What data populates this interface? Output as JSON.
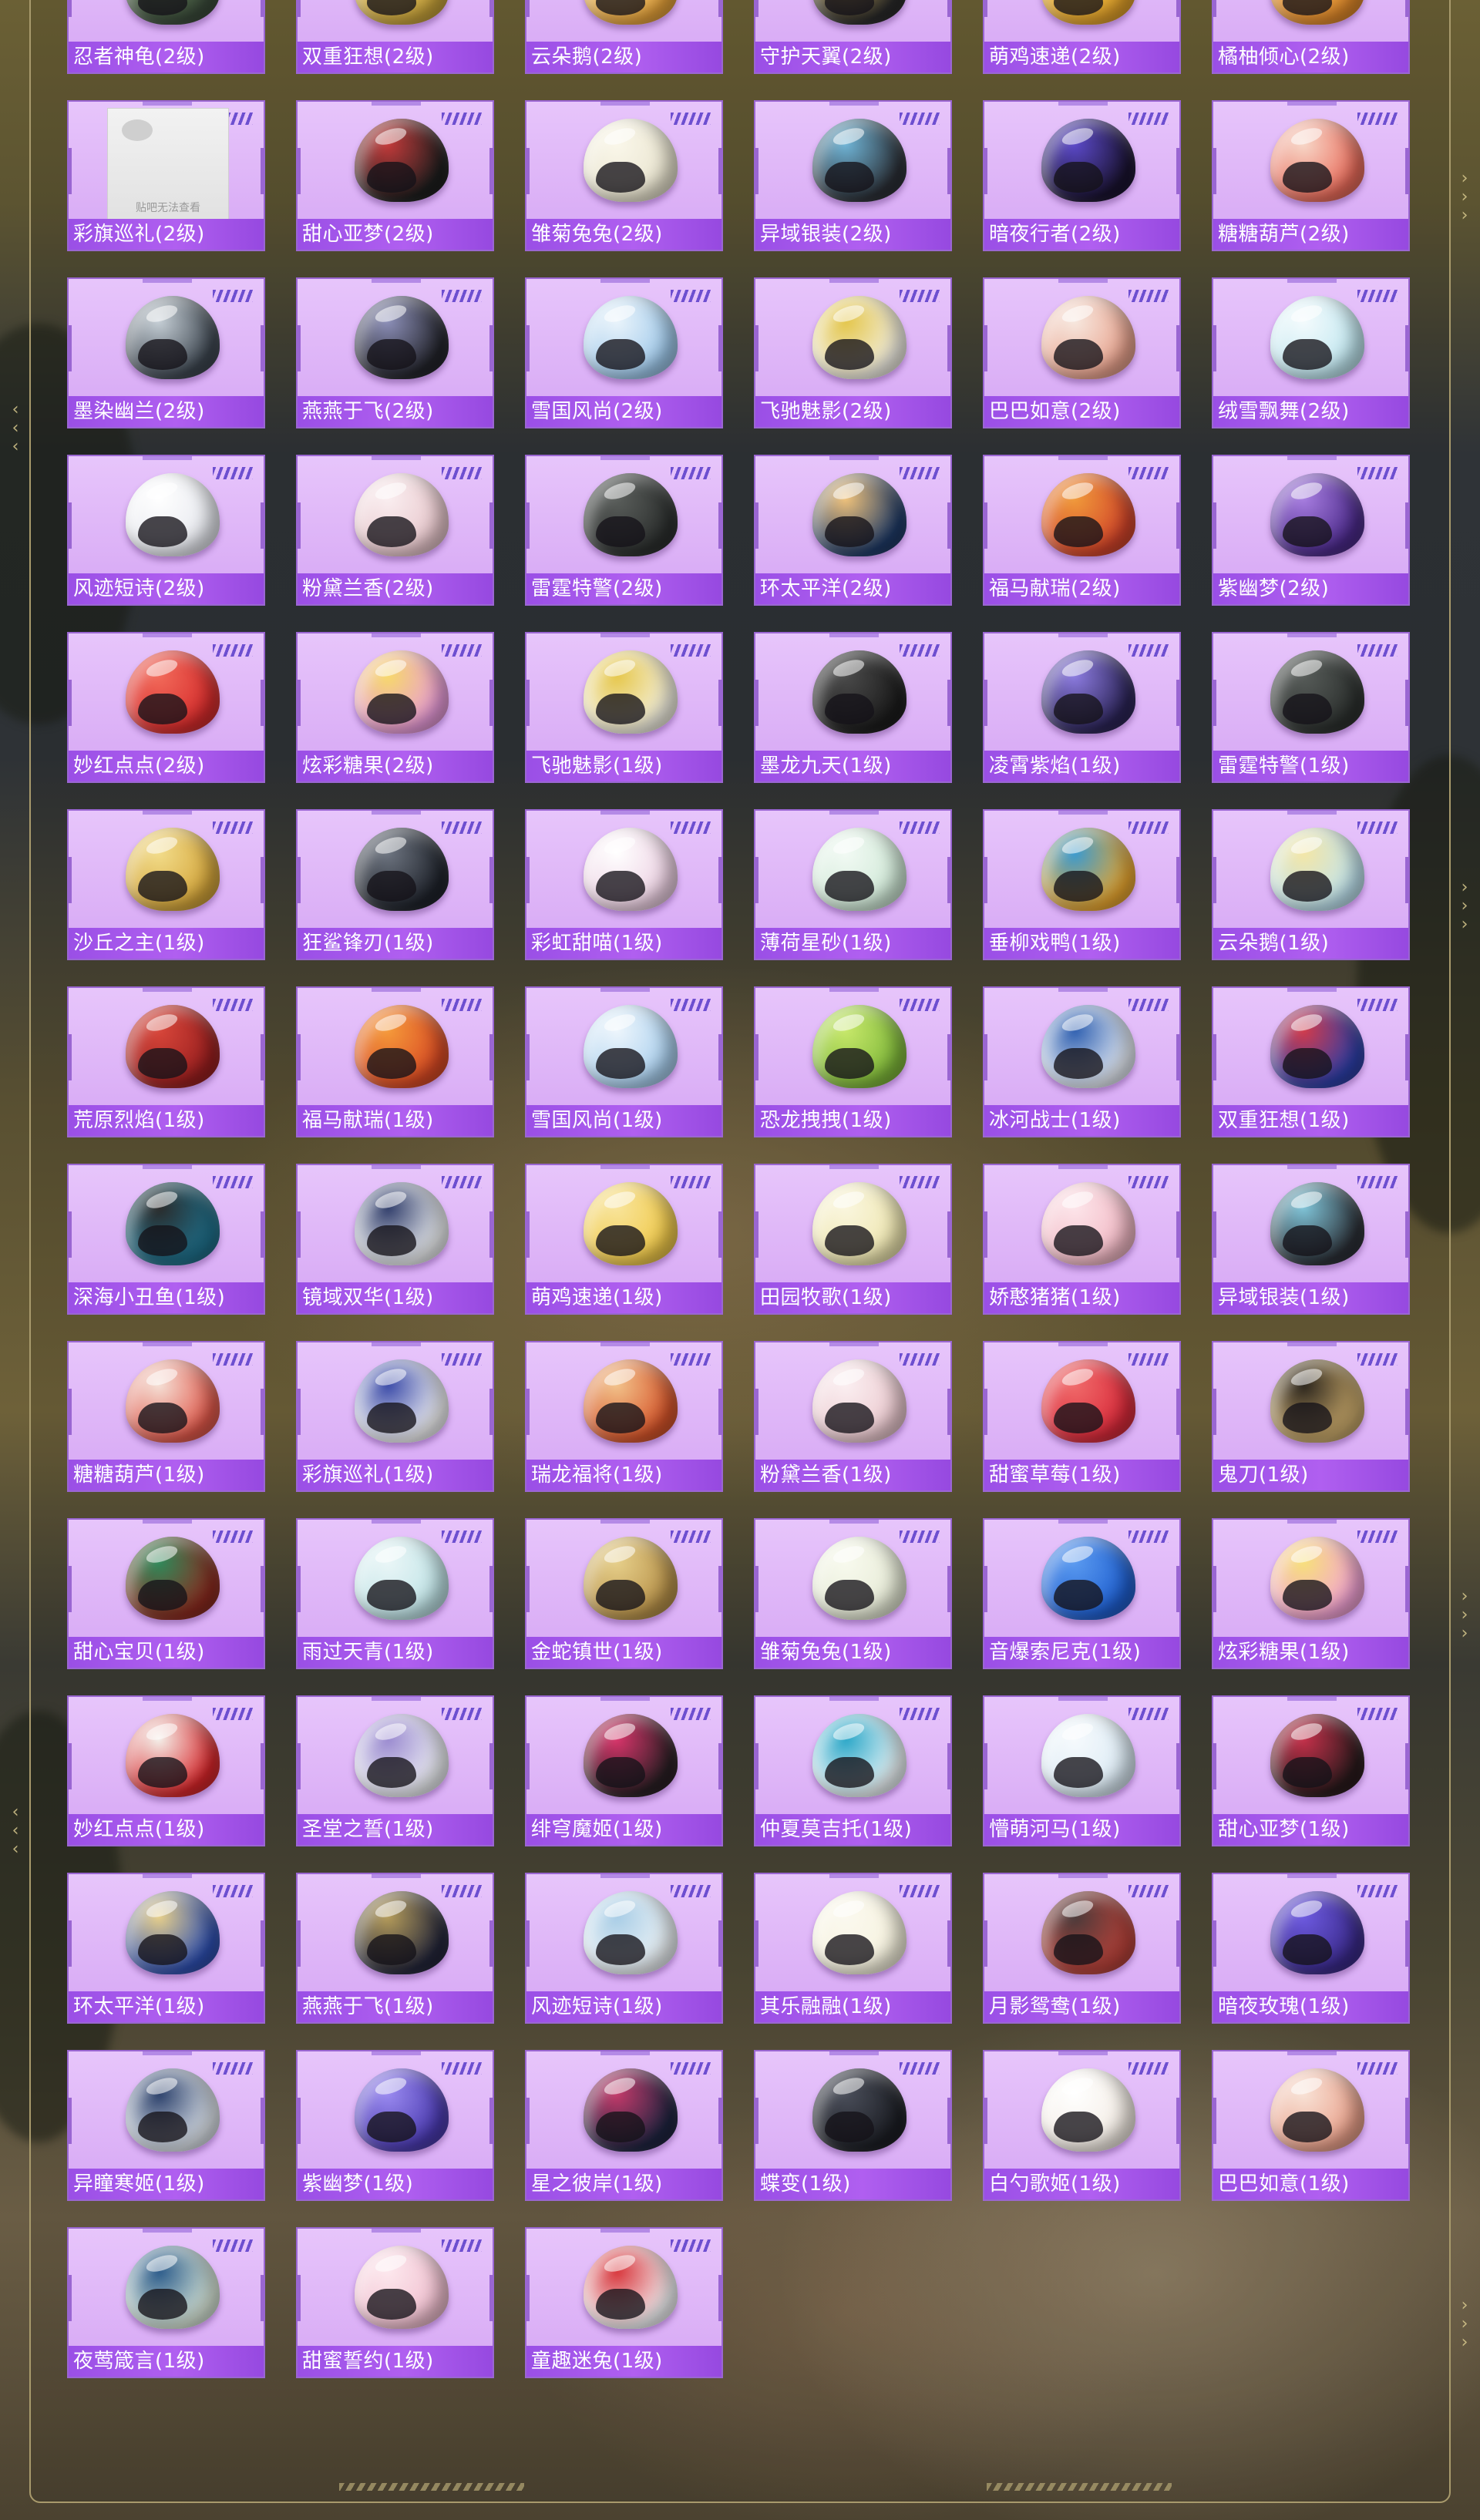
{
  "broken_image_text": "贴吧无法查看",
  "colors": {
    "card_bg": "#ddb3f7",
    "label_bg": "#a855f0",
    "label_text": "#ffffff"
  },
  "items": [
    {
      "name": "忍者神龟(2级)",
      "c1": "#3a4a3a",
      "c2": "#6b8a5a",
      "icon": "helmet-icon"
    },
    {
      "name": "双重狂想(2级)",
      "c1": "#c7a23a",
      "c2": "#efd17a",
      "icon": "helmet-icon"
    },
    {
      "name": "云朵鹅(2级)",
      "c1": "#e6a23a",
      "c2": "#f7e7b0",
      "icon": "helmet-icon"
    },
    {
      "name": "守护天翼(2级)",
      "c1": "#2a2a2a",
      "c2": "#d4b25a",
      "icon": "helmet-icon"
    },
    {
      "name": "萌鸡速递(2级)",
      "c1": "#e2a12a",
      "c2": "#f4d25a",
      "icon": "helmet-icon"
    },
    {
      "name": "橘柚倾心(2级)",
      "c1": "#e0892a",
      "c2": "#f5c06a",
      "icon": "helmet-icon"
    },
    {
      "name": "彩旗巡礼(2级)",
      "c1": "#e8e8e8",
      "c2": "#ffffff",
      "icon": "broken-image-icon",
      "broken": true
    },
    {
      "name": "甜心亚梦(2级)",
      "c1": "#1e1e1e",
      "c2": "#c33a3a",
      "icon": "helmet-icon"
    },
    {
      "name": "雏菊兔兔(2级)",
      "c1": "#e9e4cf",
      "c2": "#faf7ea",
      "icon": "helmet-icon"
    },
    {
      "name": "异域银装(2级)",
      "c1": "#2b2f36",
      "c2": "#6fb4d6",
      "icon": "helmet-icon"
    },
    {
      "name": "暗夜行者(2级)",
      "c1": "#1a1330",
      "c2": "#5b49c9",
      "icon": "helmet-icon"
    },
    {
      "name": "糖糖葫芦(2级)",
      "c1": "#e96b5a",
      "c2": "#f7d7c8",
      "icon": "helmet-icon"
    },
    {
      "name": "墨染幽兰(2级)",
      "c1": "#3d4650",
      "c2": "#c6cfd6",
      "icon": "helmet-icon"
    },
    {
      "name": "燕燕于飞(2级)",
      "c1": "#23242b",
      "c2": "#8c8fb8",
      "icon": "helmet-icon"
    },
    {
      "name": "雪国风尚(2级)",
      "c1": "#9ec8ea",
      "c2": "#eaf4fb",
      "icon": "helmet-icon"
    },
    {
      "name": "飞驰魅影(2级)",
      "c1": "#f2efe4",
      "c2": "#e4c64a",
      "icon": "helmet-icon"
    },
    {
      "name": "巴巴如意(2级)",
      "c1": "#e8a28d",
      "c2": "#f7e8df",
      "icon": "helmet-icon"
    },
    {
      "name": "绒雪飘舞(2级)",
      "c1": "#bfe6ef",
      "c2": "#f4fbfd",
      "icon": "helmet-icon"
    },
    {
      "name": "风迹短诗(2级)",
      "c1": "#e6e8ee",
      "c2": "#ffffff",
      "icon": "helmet-icon"
    },
    {
      "name": "粉黛兰香(2级)",
      "c1": "#e7c6cb",
      "c2": "#faeef0",
      "icon": "helmet-icon"
    },
    {
      "name": "雷霆特警(2级)",
      "c1": "#2c2f2e",
      "c2": "#5a5e5b",
      "icon": "helmet-icon"
    },
    {
      "name": "环太平洋(2级)",
      "c1": "#1f3a66",
      "c2": "#f0c27a",
      "icon": "helmet-icon"
    },
    {
      "name": "福马献瑞(2级)",
      "c1": "#d2442a",
      "c2": "#f09a3a",
      "icon": "helmet-icon"
    },
    {
      "name": "紫幽梦(2级)",
      "c1": "#4b2a8a",
      "c2": "#a77de0",
      "icon": "helmet-icon"
    },
    {
      "name": "妙红点点(2级)",
      "c1": "#d62c2c",
      "c2": "#f26a5a",
      "icon": "helmet-icon"
    },
    {
      "name": "炫彩糖果(2级)",
      "c1": "#e79ad8",
      "c2": "#f7d96a",
      "icon": "helmet-icon"
    },
    {
      "name": "飞驰魅影(1级)",
      "c1": "#f4f1e2",
      "c2": "#e6c74a",
      "icon": "helmet-icon"
    },
    {
      "name": "墨龙九天(1级)",
      "c1": "#1c1c1c",
      "c2": "#4a4a4a",
      "icon": "helmet-icon"
    },
    {
      "name": "凌霄紫焰(1级)",
      "c1": "#2b2456",
      "c2": "#8c7be0",
      "icon": "helmet-icon"
    },
    {
      "name": "雷霆特警(1级)",
      "c1": "#2c302e",
      "c2": "#575c59",
      "icon": "helmet-icon"
    },
    {
      "name": "沙丘之主(1级)",
      "c1": "#d4a53a",
      "c2": "#f2dc8a",
      "icon": "helmet-icon"
    },
    {
      "name": "狂鲨锋刃(1级)",
      "c1": "#1f232b",
      "c2": "#6d7480",
      "icon": "helmet-icon"
    },
    {
      "name": "彩虹甜喵(1级)",
      "c1": "#ecd0e2",
      "c2": "#ffffff",
      "icon": "helmet-icon"
    },
    {
      "name": "薄荷星砂(1级)",
      "c1": "#cfe8d6",
      "c2": "#f2faf4",
      "icon": "helmet-icon"
    },
    {
      "name": "垂柳戏鸭(1级)",
      "c1": "#e8a630",
      "c2": "#3a9ad0",
      "icon": "helmet-icon"
    },
    {
      "name": "云朵鹅(1级)",
      "c1": "#bfe3ef",
      "c2": "#f4e6a6",
      "icon": "helmet-icon"
    },
    {
      "name": "荒原烈焰(1级)",
      "c1": "#9a1f1f",
      "c2": "#d8463a",
      "icon": "helmet-icon"
    },
    {
      "name": "福马献瑞(1级)",
      "c1": "#d94a24",
      "c2": "#f59a3a",
      "icon": "helmet-icon"
    },
    {
      "name": "雪国风尚(1级)",
      "c1": "#a9cfee",
      "c2": "#eef6fc",
      "icon": "helmet-icon"
    },
    {
      "name": "恐龙拽拽(1级)",
      "c1": "#7fb83a",
      "c2": "#c7e86a",
      "icon": "helmet-icon"
    },
    {
      "name": "冰河战士(1级)",
      "c1": "#e6ecf5",
      "c2": "#2e5fb0",
      "icon": "helmet-icon"
    },
    {
      "name": "双重狂想(1级)",
      "c1": "#2d3fa8",
      "c2": "#d23a4a",
      "icon": "helmet-icon"
    },
    {
      "name": "深海小丑鱼(1级)",
      "c1": "#1f6f8a",
      "c2": "#2a2a2a",
      "icon": "helmet-icon"
    },
    {
      "name": "镜域双华(1级)",
      "c1": "#eef0f2",
      "c2": "#2f3c6a",
      "icon": "helmet-icon"
    },
    {
      "name": "萌鸡速递(1级)",
      "c1": "#f0c94a",
      "c2": "#f8e49a",
      "icon": "helmet-icon"
    },
    {
      "name": "田园牧歌(1级)",
      "c1": "#eee6b0",
      "c2": "#faf6de",
      "icon": "helmet-icon"
    },
    {
      "name": "娇憨猪猪(1级)",
      "c1": "#f1b8c4",
      "c2": "#fde5ea",
      "icon": "helmet-icon"
    },
    {
      "name": "异域银装(1级)",
      "c1": "#2b2f36",
      "c2": "#7fc4d8",
      "icon": "helmet-icon"
    },
    {
      "name": "糖糖葫芦(1级)",
      "c1": "#e0584a",
      "c2": "#f5e0d6",
      "icon": "helmet-icon"
    },
    {
      "name": "彩旗巡礼(1级)",
      "c1": "#f4f4f6",
      "c2": "#3a4aa8",
      "icon": "helmet-icon"
    },
    {
      "name": "瑞龙福将(1级)",
      "c1": "#d6542a",
      "c2": "#f2c28a",
      "icon": "helmet-icon"
    },
    {
      "name": "粉黛兰香(1级)",
      "c1": "#ebc9cf",
      "c2": "#fbeff1",
      "icon": "helmet-icon"
    },
    {
      "name": "甜蜜草莓(1级)",
      "c1": "#d92a3a",
      "c2": "#f06a6a",
      "icon": "helmet-icon"
    },
    {
      "name": "鬼刀(1级)",
      "c1": "#c8a86a",
      "c2": "#2a241c",
      "icon": "helmet-icon"
    },
    {
      "name": "甜心宝贝(1级)",
      "c1": "#8a2a1f",
      "c2": "#2e8a5a",
      "icon": "helmet-icon"
    },
    {
      "name": "雨过天青(1级)",
      "c1": "#bfe3e6",
      "c2": "#eaf6f7",
      "icon": "helmet-icon"
    },
    {
      "name": "金蛇镇世(1级)",
      "c1": "#b8924a",
      "c2": "#e6cf8a",
      "icon": "helmet-icon"
    },
    {
      "name": "雏菊兔兔(1级)",
      "c1": "#e6ead6",
      "c2": "#f8faee",
      "icon": "helmet-icon"
    },
    {
      "name": "音爆索尼克(1级)",
      "c1": "#1f5fd0",
      "c2": "#5a9af0",
      "icon": "helmet-icon"
    },
    {
      "name": "炫彩糖果(1级)",
      "c1": "#f2a2d4",
      "c2": "#f7e07a",
      "icon": "helmet-icon"
    },
    {
      "name": "妙红点点(1级)",
      "c1": "#d8262a",
      "c2": "#f4f0ea",
      "icon": "helmet-icon"
    },
    {
      "name": "圣堂之誓(1级)",
      "c1": "#eef0f4",
      "c2": "#9a8ad0",
      "icon": "helmet-icon"
    },
    {
      "name": "绯穹魔姬(1级)",
      "c1": "#2a1f24",
      "c2": "#d8346a",
      "icon": "helmet-icon"
    },
    {
      "name": "仲夏莫吉托(1级)",
      "c1": "#eef6f8",
      "c2": "#2aa7c8",
      "icon": "helmet-icon"
    },
    {
      "name": "懵萌河马(1级)",
      "c1": "#dbeaf4",
      "c2": "#f6fafd",
      "icon": "helmet-icon"
    },
    {
      "name": "甜心亚梦(1级)",
      "c1": "#2a1a1c",
      "c2": "#c4304a",
      "icon": "helmet-icon"
    },
    {
      "name": "环太平洋(1级)",
      "c1": "#2e4fb0",
      "c2": "#e8d08a",
      "icon": "helmet-icon"
    },
    {
      "name": "燕燕于飞(1级)",
      "c1": "#24263a",
      "c2": "#b59c5a",
      "icon": "helmet-icon"
    },
    {
      "name": "风迹短诗(1级)",
      "c1": "#eef3f6",
      "c2": "#a8cde6",
      "icon": "helmet-icon"
    },
    {
      "name": "其乐融融(1级)",
      "c1": "#f6f2de",
      "c2": "#fbf9ef",
      "icon": "helmet-icon"
    },
    {
      "name": "月影鸳鸯(1级)",
      "c1": "#b8423a",
      "c2": "#4a3a3a",
      "icon": "helmet-icon"
    },
    {
      "name": "暗夜玫瑰(1级)",
      "c1": "#3a2a8a",
      "c2": "#6d5ae0",
      "icon": "helmet-icon"
    },
    {
      "name": "异瞳寒姬(1级)",
      "c1": "#dde3ea",
      "c2": "#2a3f6a",
      "icon": "helmet-icon"
    },
    {
      "name": "紫幽梦(1级)",
      "c1": "#4a3ab0",
      "c2": "#9a8af0",
      "icon": "helmet-icon"
    },
    {
      "name": "星之彼岸(1级)",
      "c1": "#1f2440",
      "c2": "#c43a6a",
      "icon": "helmet-icon"
    },
    {
      "name": "蝶变(1级)",
      "c1": "#1c1e24",
      "c2": "#4a4e5a",
      "icon": "helmet-icon"
    },
    {
      "name": "白勺歌姬(1级)",
      "c1": "#f3ece4",
      "c2": "#ffffff",
      "icon": "helmet-icon"
    },
    {
      "name": "巴巴如意(1级)",
      "c1": "#e9a08a",
      "c2": "#f8e2d6",
      "icon": "helmet-icon"
    },
    {
      "name": "夜莺箴言(1级)",
      "c1": "#d8e6d8",
      "c2": "#2a5a8a",
      "icon": "helmet-icon"
    },
    {
      "name": "甜蜜誓约(1级)",
      "c1": "#f0bfcf",
      "c2": "#fde8ee",
      "icon": "helmet-icon"
    },
    {
      "name": "童趣迷兔(1级)",
      "c1": "#f4f4f6",
      "c2": "#d8343a",
      "icon": "helmet-icon"
    }
  ]
}
